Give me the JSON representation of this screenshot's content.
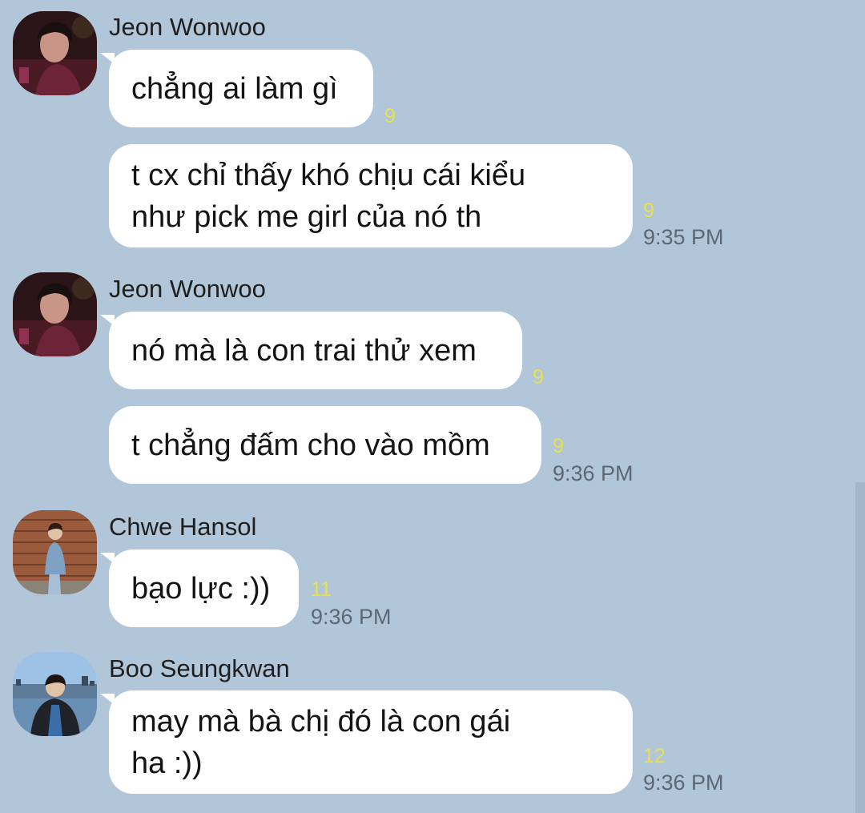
{
  "chat": {
    "colors": {
      "background": "#b2c6da",
      "bubble": "#ffffff",
      "unread": "#e9e04b",
      "time": "#5d6874"
    },
    "groups": [
      {
        "sender": "Jeon Wonwoo",
        "avatar_icon": "avatar-jeon-wonwoo",
        "messages": [
          {
            "lines": [
              "chẳng ai làm gì"
            ],
            "unread": "9",
            "time": ""
          },
          {
            "lines": [
              "t cx chỉ thấy khó chịu cái kiểu",
              "như pick me girl của nó th"
            ],
            "unread": "9",
            "time": "9:35 PM"
          }
        ]
      },
      {
        "sender": "Jeon Wonwoo",
        "avatar_icon": "avatar-jeon-wonwoo",
        "messages": [
          {
            "lines": [
              "nó mà là con trai thử xem"
            ],
            "unread": "9",
            "time": ""
          },
          {
            "lines": [
              "t chẳng đấm cho vào mồm"
            ],
            "unread": "9",
            "time": "9:36 PM"
          }
        ]
      },
      {
        "sender": "Chwe Hansol",
        "avatar_icon": "avatar-chwe-hansol",
        "messages": [
          {
            "lines": [
              "bạo lực :))"
            ],
            "unread": "11",
            "time": "9:36 PM"
          }
        ]
      },
      {
        "sender": "Boo Seungkwan",
        "avatar_icon": "avatar-boo-seungkwan",
        "messages": [
          {
            "lines": [
              "may mà bà chị đó là con gái",
              "ha :))"
            ],
            "unread": "12",
            "time": "9:36 PM"
          }
        ]
      }
    ]
  }
}
